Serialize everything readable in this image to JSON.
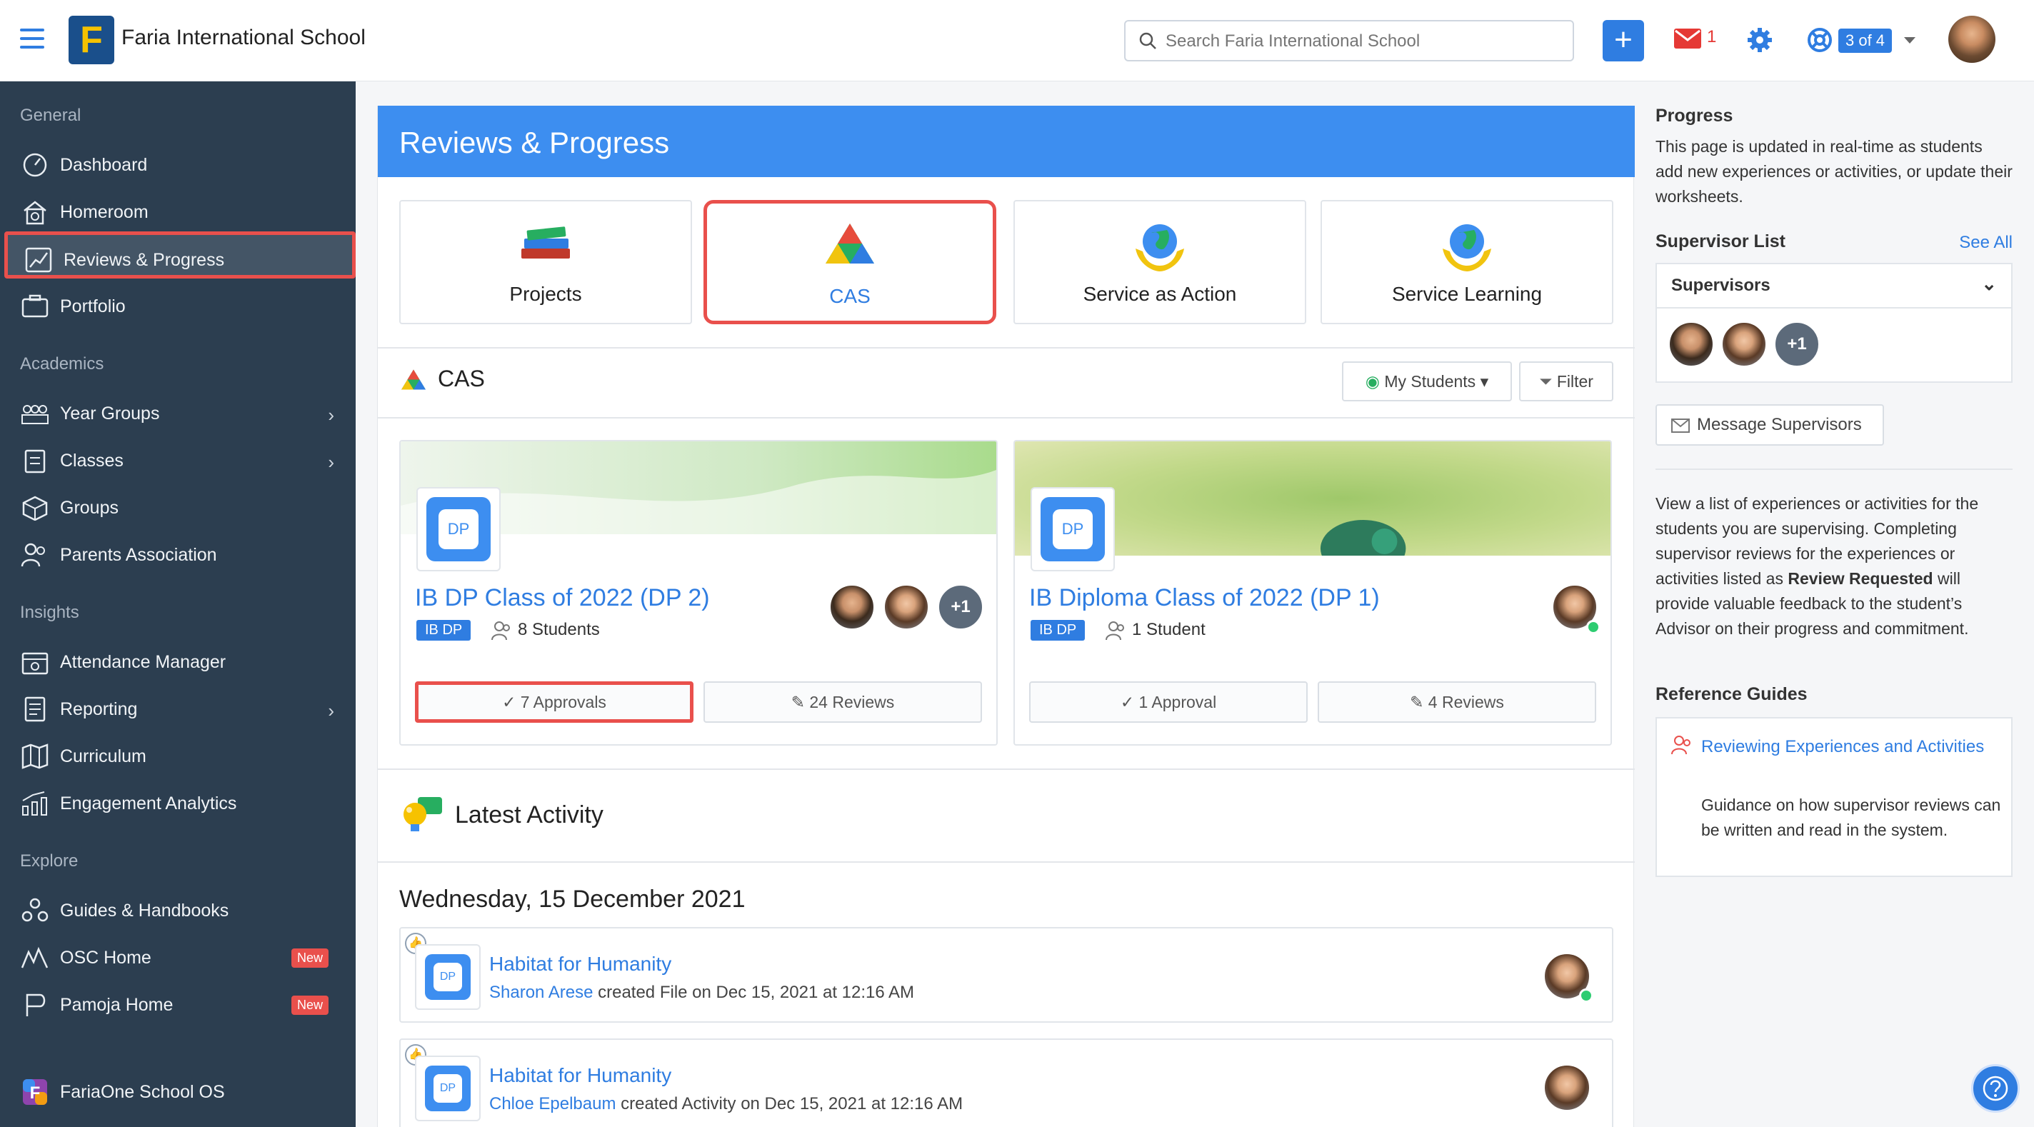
{
  "header": {
    "school_name": "Faria International School",
    "logo_letter": "F",
    "search_placeholder": "Search Faria International School",
    "add_label": "+",
    "mail_count": "1",
    "pager": "3 of 4",
    "accent": "#2f7de1"
  },
  "sidebar": {
    "sections": [
      {
        "title": "General"
      },
      {
        "title": "Academics"
      },
      {
        "title": "Insights"
      },
      {
        "title": "Explore"
      }
    ],
    "items": [
      {
        "label": "Dashboard",
        "icon": "dashboard-icon"
      },
      {
        "label": "Homeroom",
        "icon": "homeroom-icon"
      },
      {
        "label": "Reviews & Progress",
        "icon": "chart-icon"
      },
      {
        "label": "Portfolio",
        "icon": "portfolio-icon"
      },
      {
        "label": "Year Groups",
        "icon": "year-groups-icon"
      },
      {
        "label": "Classes",
        "icon": "classes-icon"
      },
      {
        "label": "Groups",
        "icon": "groups-icon"
      },
      {
        "label": "Parents Association",
        "icon": "parents-icon"
      },
      {
        "label": "Attendance Manager",
        "icon": "attendance-icon"
      },
      {
        "label": "Reporting",
        "icon": "reporting-icon"
      },
      {
        "label": "Curriculum",
        "icon": "curriculum-icon"
      },
      {
        "label": "Engagement Analytics",
        "icon": "analytics-icon"
      },
      {
        "label": "Guides & Handbooks",
        "icon": "guides-icon"
      },
      {
        "label": "OSC Home",
        "icon": "osc-icon"
      },
      {
        "label": "Pamoja Home",
        "icon": "pamoja-icon"
      },
      {
        "label": "FariaOne School OS",
        "icon": "fariaone-icon"
      }
    ],
    "chevron": "›",
    "new_badge": "New"
  },
  "main": {
    "banner_title": "Reviews & Progress",
    "tiles": [
      {
        "label": "Projects"
      },
      {
        "label": "CAS"
      },
      {
        "label": "Service as Action"
      },
      {
        "label": "Service Learning"
      }
    ],
    "section_title": "CAS",
    "my_students": "My Students",
    "filter": "Filter",
    "classes": [
      {
        "dp": "DP",
        "title": "IB DP Class of 2022 (DP 2)",
        "tag": "IB DP",
        "students": "8 Students",
        "extra": "+1",
        "approvals": "7 Approvals",
        "reviews": "24 Reviews"
      },
      {
        "dp": "DP",
        "title": "IB Diploma Class of 2022 (DP 1)",
        "tag": "IB DP",
        "students": "1 Student",
        "approvals": "1 Approval",
        "reviews": "4 Reviews"
      }
    ],
    "latest_title": "Latest Activity",
    "date": "Wednesday, 15 December 2021",
    "activities": [
      {
        "dp": "DP",
        "title": "Habitat for Humanity",
        "who": "Sharon Arese",
        "rest": " created File on Dec 15, 2021 at 12:16 AM"
      },
      {
        "dp": "DP",
        "title": "Habitat for Humanity",
        "who": "Chloe Epelbaum",
        "rest": " created Activity on Dec 15, 2021 at 12:16 AM"
      }
    ]
  },
  "right": {
    "progress_title": "Progress",
    "progress_text": "This page is updated in real-time as students add new experiences or activities, or update their worksheets.",
    "supervisor_list": "Supervisor List",
    "see_all": "See All",
    "supervisors_label": "Supervisors",
    "extra": "+1",
    "message_button": "Message Supervisors",
    "info_pre": "View a list of experiences or activities for the students you are supervising. Completing supervisor reviews for the experiences or activities listed as ",
    "info_bold": "Review Requested",
    "info_post": " will provide valuable feedback to the student’s Advisor on their progress and commitment.",
    "ref_title": "Reference Guides",
    "ref_link": "Reviewing Experiences and Activities",
    "ref_text": "Guidance on how supervisor reviews can be written and read in the system."
  }
}
